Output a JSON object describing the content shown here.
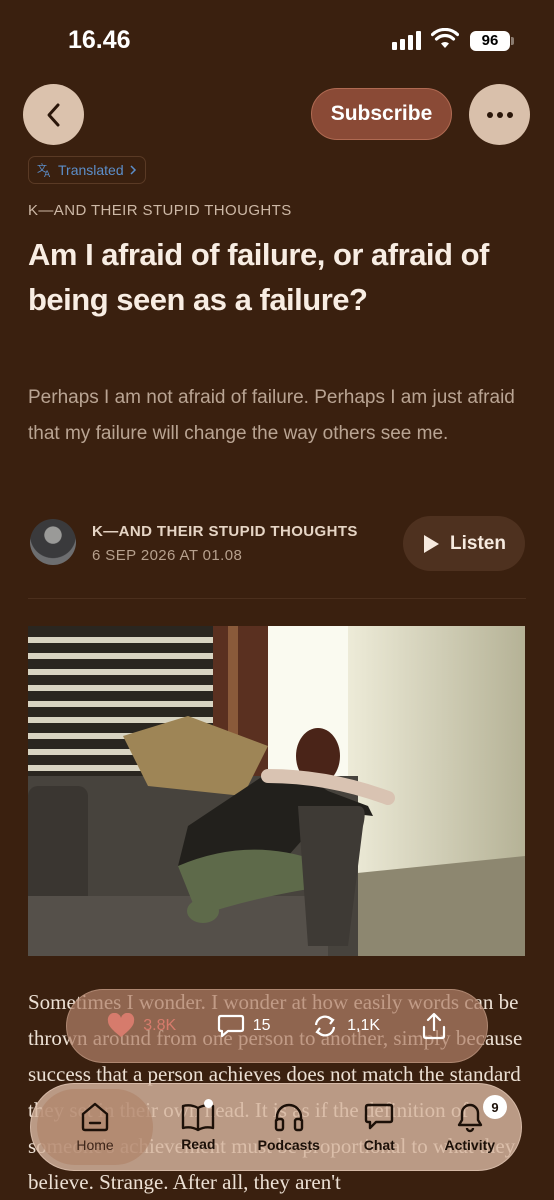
{
  "status": {
    "time": "16.46",
    "battery": "96"
  },
  "header": {
    "subscribe_label": "Subscribe"
  },
  "translated_label": "Translated",
  "post": {
    "publication": "K—AND THEIR STUPID THOUGHTS",
    "title": "Am I afraid of failure, or afraid of being seen as a failure?",
    "subtitle": "Perhaps I am not afraid of failure. Perhaps I am just afraid that my failure will change the way others see me.",
    "author": "K—AND THEIR STUPID THOUGHTS",
    "date": "6 SEP 2026 AT 01.08",
    "listen_label": "Listen",
    "body_text": "Sometimes I wonder. I wonder at how easily words can be thrown around from one person to another, simply because success that a person achieves does not match the standard they set in their own head. It is as if the definition of someone's achievement must be proportional to what they believe. Strange. After all, they aren't"
  },
  "actions": {
    "likes": "3.8K",
    "comments": "15",
    "restacks": "1,1K"
  },
  "tabs": [
    {
      "label": "Home",
      "icon": "home-icon"
    },
    {
      "label": "Read",
      "icon": "book-icon"
    },
    {
      "label": "Podcasts",
      "icon": "headphones-icon"
    },
    {
      "label": "Chat",
      "icon": "chat-icon"
    },
    {
      "label": "Activity",
      "icon": "bell-icon",
      "badge": "9"
    }
  ],
  "colors": {
    "background": "#3a200f",
    "subscribe": "#8a4a36",
    "accent_blue": "#5c8ec9",
    "like": "#d67b6c"
  }
}
